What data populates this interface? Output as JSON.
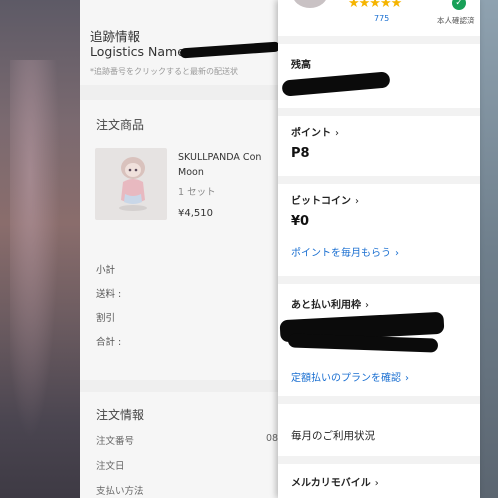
{
  "tracking": {
    "title": "追跡情報",
    "logistics_label": "Logistics Name",
    "note": "*追跡番号をクリックすると最新の配送状"
  },
  "products": {
    "header": "注文商品",
    "item": {
      "name_line1": "SKULLPANDA Con",
      "name_line2": "Moon",
      "quantity": "1 セット",
      "price": "¥4,510"
    },
    "summary": [
      "小計",
      "送料 :",
      "割引",
      "合計 :"
    ]
  },
  "order_info": {
    "header": "注文情報",
    "rows": [
      "注文番号",
      "注文日",
      "支払い方法"
    ],
    "order_number_prefix": "08"
  },
  "drawer": {
    "rating": {
      "stars": "★★★★★",
      "review_count": "775",
      "verified_label": "本人確認済",
      "verified_icon": "check-icon"
    },
    "balance_label": "残高",
    "points": {
      "label": "ポイント",
      "value": "P8"
    },
    "bitcoin": {
      "label": "ビットコイン",
      "value": "¥0",
      "link": "ポイントを毎月もらう"
    },
    "deferred": {
      "label": "あと払い利用枠",
      "link": "定額払いのプランを確認"
    },
    "monthly_usage": "毎月のご利用状況",
    "mobile": "メルカリモバイル"
  },
  "colors": {
    "link": "#1a6fd1",
    "star": "#f5b400",
    "verified": "#18a058"
  }
}
